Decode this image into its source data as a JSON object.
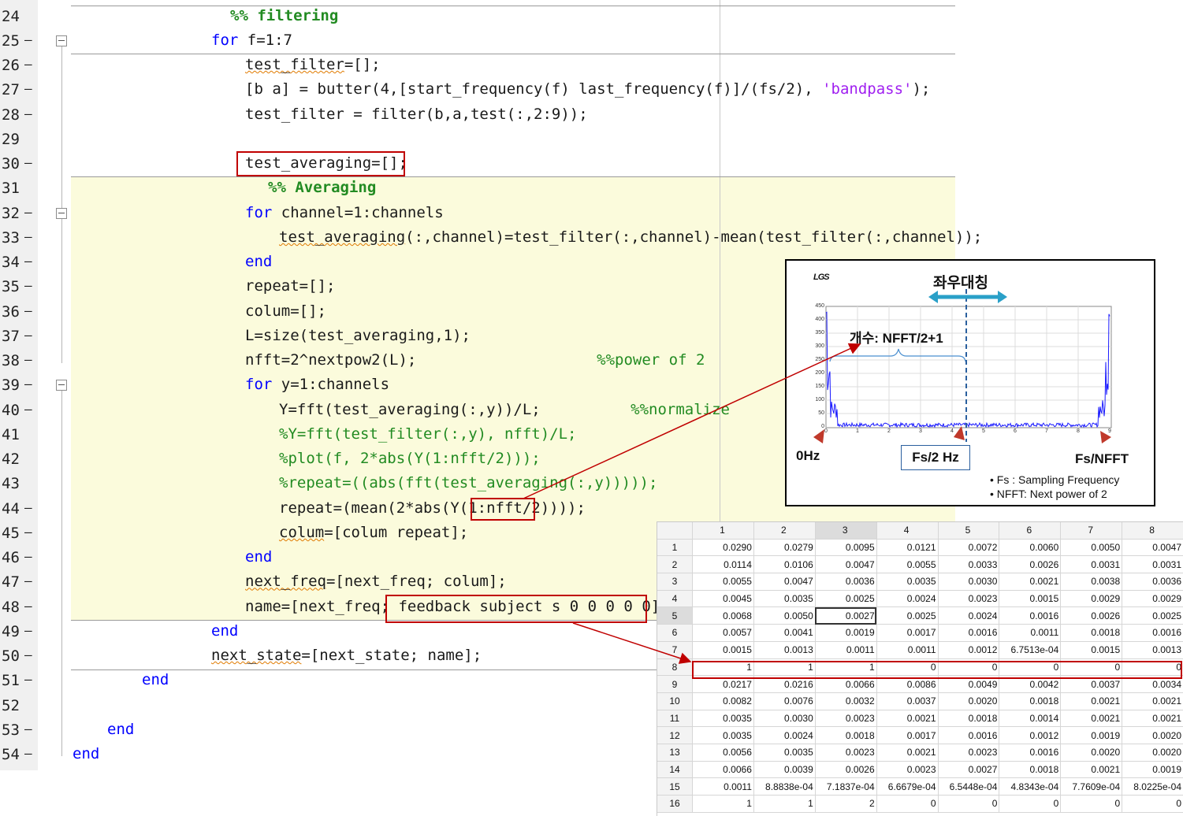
{
  "editor": {
    "lines": [
      {
        "num": "24",
        "dash": "",
        "indent": 292,
        "tokens": [
          {
            "t": "%% filtering",
            "c": "cmb"
          }
        ]
      },
      {
        "num": "25",
        "dash": "–",
        "indent": 268,
        "fold": true,
        "tokens": [
          {
            "t": "for",
            "c": "kw"
          },
          {
            "t": " f=1:7"
          }
        ]
      },
      {
        "num": "26",
        "dash": "–",
        "indent": 311,
        "tokens": [
          {
            "t": "test_filter",
            "c": "sq"
          },
          {
            "t": "=[];"
          }
        ]
      },
      {
        "num": "27",
        "dash": "–",
        "indent": 311,
        "tokens": [
          {
            "t": "[b a] = butter(4,[start_frequency(f) last_frequency(f)]/(fs/2), "
          },
          {
            "t": "'bandpass'",
            "c": "str"
          },
          {
            "t": ");"
          }
        ]
      },
      {
        "num": "28",
        "dash": "–",
        "indent": 311,
        "tokens": [
          {
            "t": "test_filter = filter(b,a,test(:,2:9));"
          }
        ]
      },
      {
        "num": "29",
        "dash": "",
        "indent": 311,
        "tokens": []
      },
      {
        "num": "30",
        "dash": "–",
        "indent": 311,
        "tokens": [
          {
            "t": "test_averaging=[];"
          }
        ]
      },
      {
        "num": "31",
        "dash": "",
        "indent": 340,
        "tokens": [
          {
            "t": "%% Averaging",
            "c": "cmb"
          }
        ]
      },
      {
        "num": "32",
        "dash": "–",
        "indent": 311,
        "fold": true,
        "tokens": [
          {
            "t": "for",
            "c": "kw"
          },
          {
            "t": " channel=1:channels"
          }
        ]
      },
      {
        "num": "33",
        "dash": "–",
        "indent": 354,
        "tokens": [
          {
            "t": "test_averaging",
            "c": "sq"
          },
          {
            "t": "(:,channel)=test_filter(:,channel)-mean(test_filter(:,channel));"
          }
        ]
      },
      {
        "num": "34",
        "dash": "–",
        "indent": 311,
        "tokens": [
          {
            "t": "end",
            "c": "kw"
          }
        ]
      },
      {
        "num": "35",
        "dash": "–",
        "indent": 311,
        "tokens": [
          {
            "t": "repeat=[];"
          }
        ]
      },
      {
        "num": "36",
        "dash": "–",
        "indent": 311,
        "tokens": [
          {
            "t": "colum=[];"
          }
        ]
      },
      {
        "num": "37",
        "dash": "–",
        "indent": 311,
        "tokens": [
          {
            "t": "L=size(test_averaging,1);"
          }
        ]
      },
      {
        "num": "38",
        "dash": "–",
        "indent": 311,
        "tokens": [
          {
            "t": "nfft=2^nextpow2(L);                    "
          },
          {
            "t": "%%power of 2",
            "c": "cm"
          }
        ]
      },
      {
        "num": "39",
        "dash": "–",
        "indent": 311,
        "fold": true,
        "tokens": [
          {
            "t": "for",
            "c": "kw"
          },
          {
            "t": " y=1:channels"
          }
        ]
      },
      {
        "num": "40",
        "dash": "–",
        "indent": 354,
        "tokens": [
          {
            "t": "Y=fft(test_averaging(:,y))/L;          "
          },
          {
            "t": "%%normalize",
            "c": "cm"
          }
        ]
      },
      {
        "num": "41",
        "dash": "",
        "indent": 354,
        "tokens": [
          {
            "t": "%Y=fft(test_filter(:,y), nfft)/L;",
            "c": "cm"
          }
        ]
      },
      {
        "num": "42",
        "dash": "",
        "indent": 354,
        "tokens": [
          {
            "t": "%plot(f, 2*abs(Y(1:nfft/2)));",
            "c": "cm"
          }
        ]
      },
      {
        "num": "43",
        "dash": "",
        "indent": 354,
        "tokens": [
          {
            "t": "%repeat=((abs(fft(test_averaging(:,y)))));",
            "c": "cm"
          }
        ]
      },
      {
        "num": "44",
        "dash": "–",
        "indent": 354,
        "tokens": [
          {
            "t": "repeat=(mean(2*abs(Y(1:nfft/2))));"
          }
        ]
      },
      {
        "num": "45",
        "dash": "–",
        "indent": 354,
        "tokens": [
          {
            "t": "colum",
            "c": "sq"
          },
          {
            "t": "=[colum repeat];"
          }
        ]
      },
      {
        "num": "46",
        "dash": "–",
        "indent": 311,
        "tokens": [
          {
            "t": "end",
            "c": "kw"
          }
        ]
      },
      {
        "num": "47",
        "dash": "–",
        "indent": 311,
        "tokens": [
          {
            "t": "next_freq",
            "c": "sq"
          },
          {
            "t": "=[next_freq; colum];"
          }
        ]
      },
      {
        "num": "48",
        "dash": "–",
        "indent": 311,
        "tokens": [
          {
            "t": "name=[next_freq; feedback subject s 0 0 0 0 0];"
          }
        ]
      },
      {
        "num": "49",
        "dash": "–",
        "indent": 268,
        "tokens": [
          {
            "t": "end",
            "c": "kw"
          }
        ]
      },
      {
        "num": "50",
        "dash": "–",
        "indent": 268,
        "tokens": [
          {
            "t": "next_state",
            "c": "sq"
          },
          {
            "t": "=[next_state; name];"
          }
        ]
      },
      {
        "num": "51",
        "dash": "–",
        "indent": 180,
        "tokens": [
          {
            "t": "end",
            "c": "kw"
          }
        ]
      },
      {
        "num": "52",
        "dash": "",
        "indent": 180,
        "tokens": []
      },
      {
        "num": "53",
        "dash": "–",
        "indent": 136,
        "tokens": [
          {
            "t": "end",
            "c": "kw"
          }
        ]
      },
      {
        "num": "54",
        "dash": "–",
        "indent": 92,
        "tokens": [
          {
            "t": "end",
            "c": "kw"
          }
        ]
      }
    ]
  },
  "figure": {
    "logo": "LGS",
    "symmetry_label": "좌우대칭",
    "count_label": "개수: NFFT/2+1",
    "zero_label": "0Hz",
    "half_label": "Fs/2 Hz",
    "nfft_label": "Fs/NFFT",
    "y_ticks": [
      "450",
      "400",
      "350",
      "300",
      "250",
      "200",
      "150",
      "100",
      "50",
      "0"
    ],
    "x_ticks": [
      "0",
      "1",
      "2",
      "3",
      "4",
      "5",
      "6",
      "7",
      "8",
      "9"
    ],
    "notes": [
      "•   Fs     : Sampling Frequency",
      "•   NFFT: Next power of 2"
    ],
    "colors": {
      "spectrum": "#1a1aff",
      "arrow_symmetry": "#2aa0c8",
      "marker": "#c0392b",
      "annotation": "#c00000"
    }
  },
  "table": {
    "headers": [
      "1",
      "2",
      "3",
      "4",
      "5",
      "6",
      "7",
      "8"
    ],
    "selected_column": "3",
    "selected_row": "5",
    "rows": [
      [
        "1",
        "0.0290",
        "0.0279",
        "0.0095",
        "0.0121",
        "0.0072",
        "0.0060",
        "0.0050",
        "0.0047"
      ],
      [
        "2",
        "0.0114",
        "0.0106",
        "0.0047",
        "0.0055",
        "0.0033",
        "0.0026",
        "0.0031",
        "0.0031"
      ],
      [
        "3",
        "0.0055",
        "0.0047",
        "0.0036",
        "0.0035",
        "0.0030",
        "0.0021",
        "0.0038",
        "0.0036"
      ],
      [
        "4",
        "0.0045",
        "0.0035",
        "0.0025",
        "0.0024",
        "0.0023",
        "0.0015",
        "0.0029",
        "0.0029"
      ],
      [
        "5",
        "0.0068",
        "0.0050",
        "0.0027",
        "0.0025",
        "0.0024",
        "0.0016",
        "0.0026",
        "0.0025"
      ],
      [
        "6",
        "0.0057",
        "0.0041",
        "0.0019",
        "0.0017",
        "0.0016",
        "0.0011",
        "0.0018",
        "0.0016"
      ],
      [
        "7",
        "0.0015",
        "0.0013",
        "0.0011",
        "0.0011",
        "0.0012",
        "6.7513e-04",
        "0.0015",
        "0.0013"
      ],
      [
        "8",
        "1",
        "1",
        "1",
        "0",
        "0",
        "0",
        "0",
        "0"
      ],
      [
        "9",
        "0.0217",
        "0.0216",
        "0.0066",
        "0.0086",
        "0.0049",
        "0.0042",
        "0.0037",
        "0.0034"
      ],
      [
        "10",
        "0.0082",
        "0.0076",
        "0.0032",
        "0.0037",
        "0.0020",
        "0.0018",
        "0.0021",
        "0.0021"
      ],
      [
        "11",
        "0.0035",
        "0.0030",
        "0.0023",
        "0.0021",
        "0.0018",
        "0.0014",
        "0.0021",
        "0.0021"
      ],
      [
        "12",
        "0.0035",
        "0.0024",
        "0.0018",
        "0.0017",
        "0.0016",
        "0.0012",
        "0.0019",
        "0.0020"
      ],
      [
        "13",
        "0.0056",
        "0.0035",
        "0.0023",
        "0.0021",
        "0.0023",
        "0.0016",
        "0.0020",
        "0.0020"
      ],
      [
        "14",
        "0.0066",
        "0.0039",
        "0.0026",
        "0.0023",
        "0.0027",
        "0.0018",
        "0.0021",
        "0.0019"
      ],
      [
        "15",
        "0.0011",
        "8.8838e-04",
        "7.1837e-04",
        "6.6679e-04",
        "6.5448e-04",
        "4.8343e-04",
        "7.7609e-04",
        "8.0225e-04"
      ],
      [
        "16",
        "1",
        "1",
        "2",
        "0",
        "0",
        "0",
        "0",
        "0"
      ]
    ]
  }
}
